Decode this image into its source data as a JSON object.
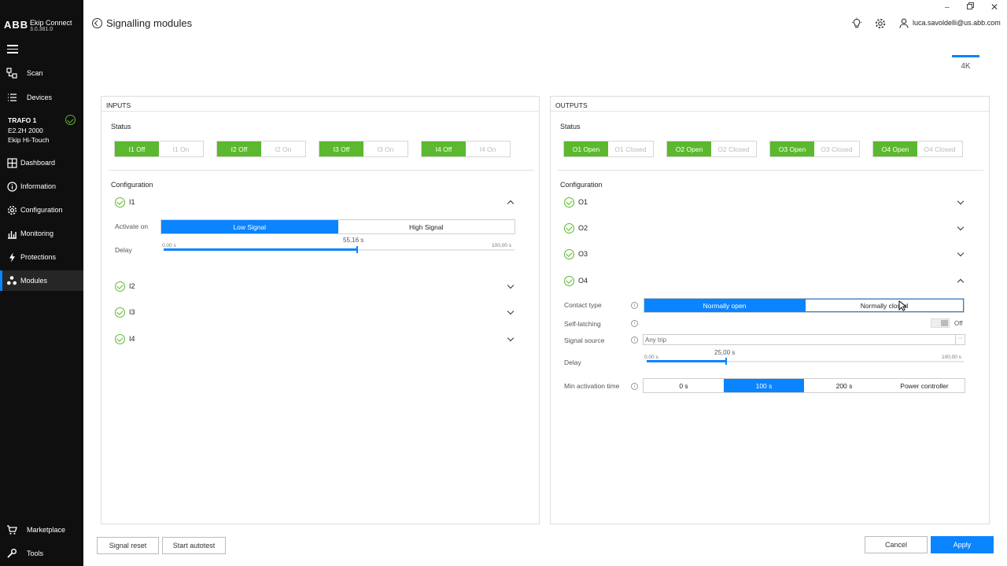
{
  "app": {
    "logo": "ABB",
    "name": "Ekip Connect",
    "version": "3.0.381.0"
  },
  "sidebar": {
    "items": [
      {
        "label": "Scan",
        "icon": "scan-icon"
      },
      {
        "label": "Devices",
        "icon": "list-icon"
      },
      {
        "label": "Dashboard",
        "icon": "dashboard-icon"
      },
      {
        "label": "Information",
        "icon": "info-icon"
      },
      {
        "label": "Configuration",
        "icon": "gear-icon"
      },
      {
        "label": "Monitoring",
        "icon": "chart-icon"
      },
      {
        "label": "Protections",
        "icon": "bolt-icon"
      },
      {
        "label": "Modules",
        "icon": "modules-icon"
      }
    ],
    "device": {
      "name": "TRAFO 1",
      "model": "E2.2H 2000",
      "type": "Ekip Hi-Touch"
    },
    "bottom": [
      {
        "label": "Marketplace",
        "icon": "cart-icon"
      },
      {
        "label": "Tools",
        "icon": "wrench-icon"
      }
    ]
  },
  "header": {
    "title": "Signalling modules",
    "user": "luca.savoldelli@us.abb.com",
    "tab": "4K"
  },
  "inputs": {
    "title": "INPUTS",
    "status_label": "Status",
    "status": [
      {
        "off": "I1 Off",
        "on": "I1 On"
      },
      {
        "off": "I2 Off",
        "on": "I2 On"
      },
      {
        "off": "I3 Off",
        "on": "I3 On"
      },
      {
        "off": "I4 Off",
        "on": "I4 On"
      }
    ],
    "config_label": "Configuration",
    "items": [
      "I1",
      "I2",
      "I3",
      "I4"
    ],
    "i1": {
      "activate_label": "Activate on",
      "low": "Low Signal",
      "high": "High Signal",
      "delay_label": "Delay",
      "delay_value": "55,16 s",
      "min": "0,00 s",
      "max": "100,00 s",
      "fraction": 0.5516
    }
  },
  "outputs": {
    "title": "OUTPUTS",
    "status_label": "Status",
    "status": [
      {
        "open": "O1 Open",
        "closed": "O1 Closed"
      },
      {
        "open": "O2 Open",
        "closed": "O2 Closed"
      },
      {
        "open": "O3 Open",
        "closed": "O3 Closed"
      },
      {
        "open": "O4 Open",
        "closed": "O4 Closed"
      }
    ],
    "config_label": "Configuration",
    "items": [
      "O1",
      "O2",
      "O3",
      "O4"
    ],
    "o4": {
      "contact_label": "Contact type",
      "normally_open": "Normally open",
      "normally_closed": "Normally closed",
      "self_latching_label": "Self-latching",
      "self_latching_value": "Off",
      "signal_source_label": "Signal source",
      "signal_source_value": "Any trip",
      "more": "···",
      "delay_label": "Delay",
      "delay_value": "25,00 s",
      "min": "0,00 s",
      "max": "100,00 s",
      "fraction": 0.25,
      "min_activation_label": "Min activation time",
      "min_activation_options": [
        "0 s",
        "100 s",
        "200 s",
        "Power controller"
      ],
      "min_activation_selected": 1
    }
  },
  "footer": {
    "signal_reset": "Signal reset",
    "start_autotest": "Start autotest",
    "cancel": "Cancel",
    "apply": "Apply"
  },
  "colors": {
    "accent": "#0a84ff",
    "status_on": "#5cb82e",
    "sidebar": "#0f0f0f"
  }
}
